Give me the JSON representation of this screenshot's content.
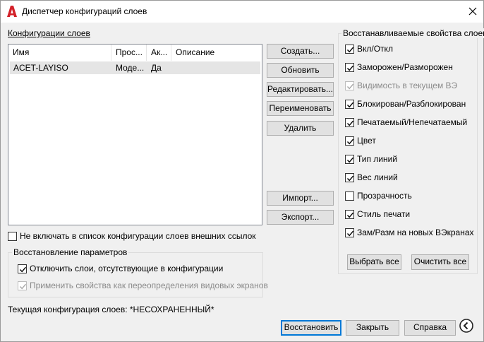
{
  "window": {
    "title": "Диспетчер конфигураций слоев",
    "app_icon": "autocad-a-icon",
    "close_icon": "close-icon"
  },
  "configs": {
    "label": "Конфигурации слоев",
    "columns": [
      "Имя",
      "Прос...",
      "Ак...",
      "Описание"
    ],
    "rows": [
      {
        "name": "ACET-LAYISO",
        "space": "Моде...",
        "active": "Да",
        "description": ""
      }
    ]
  },
  "buttons": {
    "create": "Создать...",
    "update": "Обновить",
    "edit": "Редактировать...",
    "rename": "Переименовать",
    "delete": "Удалить",
    "import": "Импорт...",
    "export": "Экспорт..."
  },
  "exclude_xref": {
    "label": "Не включать в список конфигурации слоев внешних ссылок",
    "checked": false
  },
  "restore_options": {
    "title": "Восстановление параметров",
    "turn_off_missing": {
      "label": "Отключить слои, отсутствующие в конфигурации",
      "checked": true,
      "enabled": true
    },
    "apply_as_overrides": {
      "label": "Применить свойства как переопределения видовых экранов",
      "checked": true,
      "enabled": false
    }
  },
  "properties": {
    "title": "Восстанавливаемые свойства слоев",
    "items": [
      {
        "label": "Вкл/Откл",
        "checked": true,
        "enabled": true
      },
      {
        "label": "Заморожен/Разморожен",
        "checked": true,
        "enabled": true
      },
      {
        "label": "Видимость в текущем ВЭ",
        "checked": true,
        "enabled": false
      },
      {
        "label": "Блокирован/Разблокирован",
        "checked": true,
        "enabled": true
      },
      {
        "label": "Печатаемый/Непечатаемый",
        "checked": true,
        "enabled": true
      },
      {
        "label": "Цвет",
        "checked": true,
        "enabled": true
      },
      {
        "label": "Тип линий",
        "checked": true,
        "enabled": true
      },
      {
        "label": "Вес линий",
        "checked": true,
        "enabled": true
      },
      {
        "label": "Прозрачность",
        "checked": false,
        "enabled": true
      },
      {
        "label": "Стиль печати",
        "checked": true,
        "enabled": true
      },
      {
        "label": "Зам/Разм на новых ВЭкранах",
        "checked": true,
        "enabled": true
      }
    ],
    "select_all": "Выбрать все",
    "clear_all": "Очистить все"
  },
  "current_config": "Текущая конфигурация слоев: *НЕСОХРАНЕННЫЙ*",
  "footer": {
    "restore": "Восстановить",
    "close": "Закрыть",
    "help": "Справка",
    "back_icon": "circle-chevron-left-icon"
  }
}
